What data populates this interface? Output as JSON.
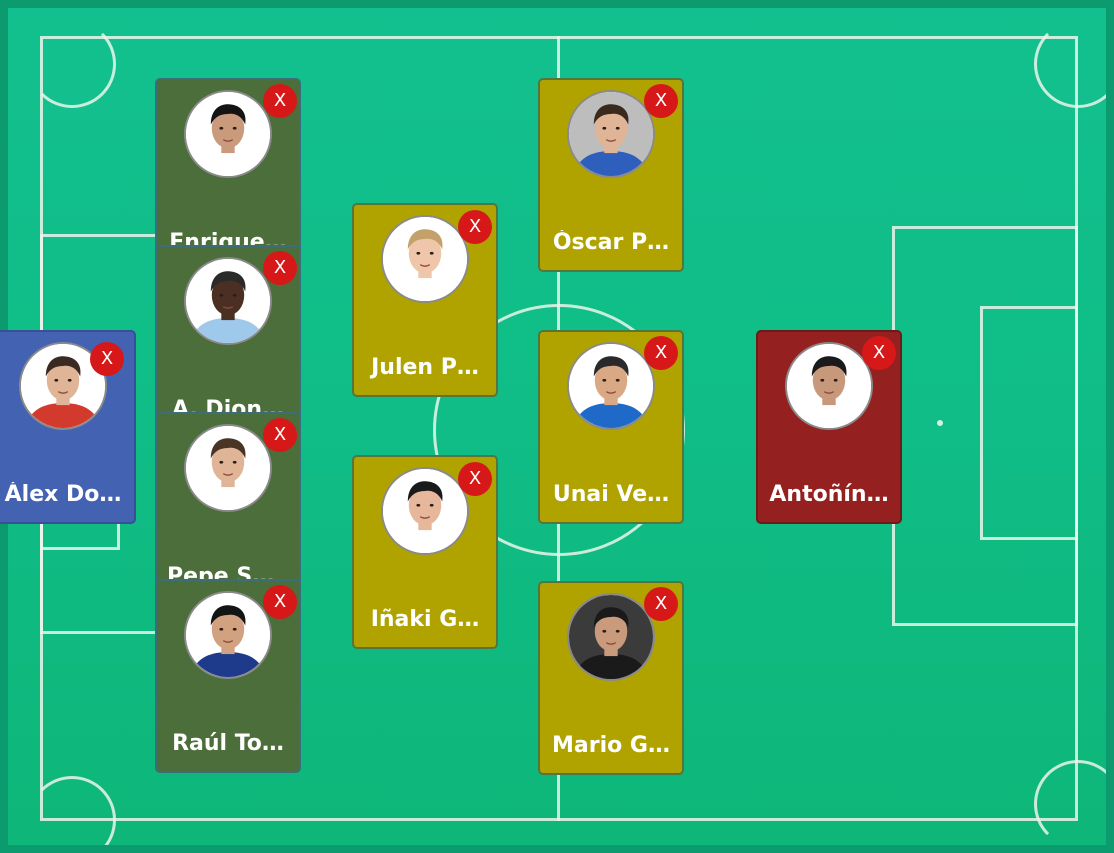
{
  "colors": {
    "pitch": "#10bd86",
    "defender_card": "#4b6e3a",
    "midfielder_card": "#b0a300",
    "goalkeeper_card": "#4462b2",
    "forward_card": "#942020",
    "remove_button": "#d61818"
  },
  "remove_label": "X",
  "players": [
    {
      "name": "Álex Do…",
      "role": "goalkeeper",
      "shirt": "#d23a2e",
      "hair": "#3b2a22",
      "skin": "#e0b496",
      "bg": "#ffffff"
    },
    {
      "name": "Enrique…",
      "role": "defender",
      "shirt": "#ffffff",
      "hair": "#141414",
      "skin": "#c99a7c",
      "bg": "#ffffff"
    },
    {
      "name": "A. Dion…",
      "role": "defender",
      "shirt": "#9ec9ea",
      "hair": "#2a2a2a",
      "skin": "#4a2f22",
      "bg": "#ffffff"
    },
    {
      "name": "Pepe Sá…",
      "role": "defender",
      "shirt": "#ffffff",
      "hair": "#4a3424",
      "skin": "#e0b496",
      "bg": "#ffffff"
    },
    {
      "name": "Raúl To…",
      "role": "defender",
      "shirt": "#1e3a8a",
      "hair": "#141414",
      "skin": "#d2a17f",
      "bg": "#ffffff"
    },
    {
      "name": "Julen P…",
      "role": "midfielder",
      "shirt": "#ffffff",
      "hair": "#c4a06a",
      "skin": "#efc6aa",
      "bg": "#ffffff"
    },
    {
      "name": "Iñaki G…",
      "role": "midfielder",
      "shirt": "#ffffff",
      "hair": "#1a1a1a",
      "skin": "#e6b79a",
      "bg": "#ffffff"
    },
    {
      "name": "Óscar P…",
      "role": "midfielder",
      "shirt": "#2f5fbd",
      "hair": "#3a2a1e",
      "skin": "#e0b496",
      "bg": "#bdbdbd"
    },
    {
      "name": "Unai Ve…",
      "role": "midfielder",
      "shirt": "#1f6ac8",
      "hair": "#2a2a2a",
      "skin": "#d9a884",
      "bg": "#ffffff"
    },
    {
      "name": "Mario G…",
      "role": "midfielder",
      "shirt": "#1a1a1a",
      "hair": "#1a1a1a",
      "skin": "#c99a7c",
      "bg": "#3b3b3b"
    },
    {
      "name": "Antoñín…",
      "role": "forward",
      "shirt": "#ffffff",
      "hair": "#1a1a1a",
      "skin": "#c8987a",
      "bg": "#ffffff"
    }
  ]
}
